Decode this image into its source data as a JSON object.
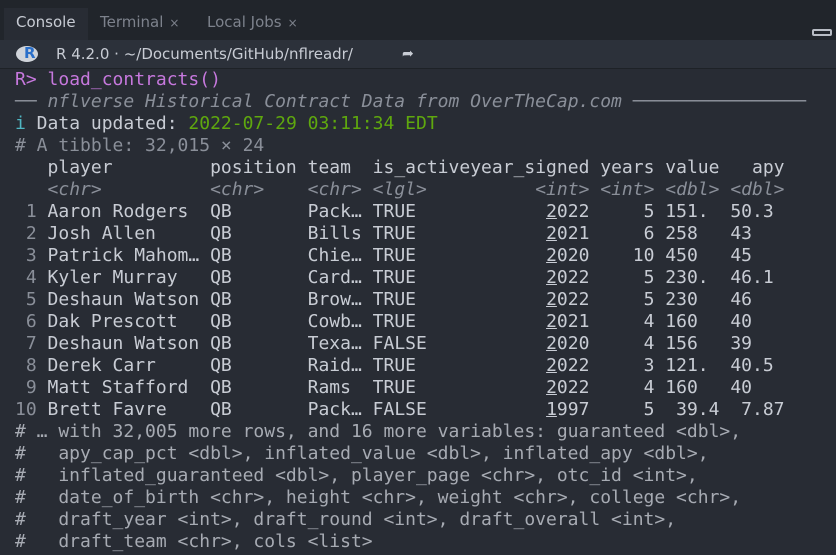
{
  "tabs": [
    {
      "label": "Console",
      "active": true
    },
    {
      "label": "Terminal",
      "close": "×"
    },
    {
      "label": "Local Jobs",
      "close": "×"
    }
  ],
  "toolbar": {
    "r_version": "R 4.2.0",
    "separator": "·",
    "path": "~/Documents/GitHub/nflreadr/",
    "logo": "R"
  },
  "console": {
    "prompt": "R>",
    "command": "load_contracts()",
    "banner_prefix": "──",
    "banner": "nflverse Historical Contract Data from OverTheCap.com",
    "banner_suffix": "────────────────",
    "info_icon": "i",
    "info_label": "Data updated:",
    "info_value": "2022-07-29 03:11:34 EDT",
    "tibble_line": "# A tibble: 32,015 × 24",
    "columns": [
      "player",
      "position",
      "team",
      "is_active",
      "year_signed",
      "years",
      "value",
      "apy"
    ],
    "types": [
      "<chr>",
      "<chr>",
      "<chr>",
      "<lgl>",
      "<int>",
      "<int>",
      "<dbl>",
      "<dbl>"
    ],
    "rows": [
      [
        "1",
        "Aaron Rodgers",
        "QB",
        "Pack…",
        "TRUE",
        "2022",
        "5",
        "151.",
        "50.3"
      ],
      [
        "2",
        "Josh Allen",
        "QB",
        "Bills",
        "TRUE",
        "2021",
        "6",
        "258",
        "43"
      ],
      [
        "3",
        "Patrick Mahom…",
        "QB",
        "Chie…",
        "TRUE",
        "2020",
        "10",
        "450",
        "45"
      ],
      [
        "4",
        "Kyler Murray",
        "QB",
        "Card…",
        "TRUE",
        "2022",
        "5",
        "230.",
        "46.1"
      ],
      [
        "5",
        "Deshaun Watson",
        "QB",
        "Brow…",
        "TRUE",
        "2022",
        "5",
        "230",
        "46"
      ],
      [
        "6",
        "Dak Prescott",
        "QB",
        "Cowb…",
        "TRUE",
        "2021",
        "4",
        "160",
        "40"
      ],
      [
        "7",
        "Deshaun Watson",
        "QB",
        "Texa…",
        "FALSE",
        "2020",
        "4",
        "156",
        "39"
      ],
      [
        "8",
        "Derek Carr",
        "QB",
        "Raid…",
        "TRUE",
        "2022",
        "3",
        "121.",
        "40.5"
      ],
      [
        "9",
        "Matt Stafford",
        "QB",
        "Rams",
        "TRUE",
        "2022",
        "4",
        "160",
        "40"
      ],
      [
        "10",
        "Brett Favre",
        "QB",
        "Pack…",
        "FALSE",
        "1997",
        "5",
        "39.4",
        "7.87"
      ]
    ],
    "footer": [
      "# … with 32,005 more rows, and 16 more variables: guaranteed <dbl>,",
      "#   apy_cap_pct <dbl>, inflated_value <dbl>, inflated_apy <dbl>,",
      "#   inflated_guaranteed <dbl>, player_page <chr>, otc_id <int>,",
      "#   date_of_birth <chr>, height <chr>, weight <chr>, college <chr>,",
      "#   draft_year <int>, draft_round <int>, draft_overall <int>,",
      "#   draft_team <chr>, cols <list>"
    ]
  }
}
